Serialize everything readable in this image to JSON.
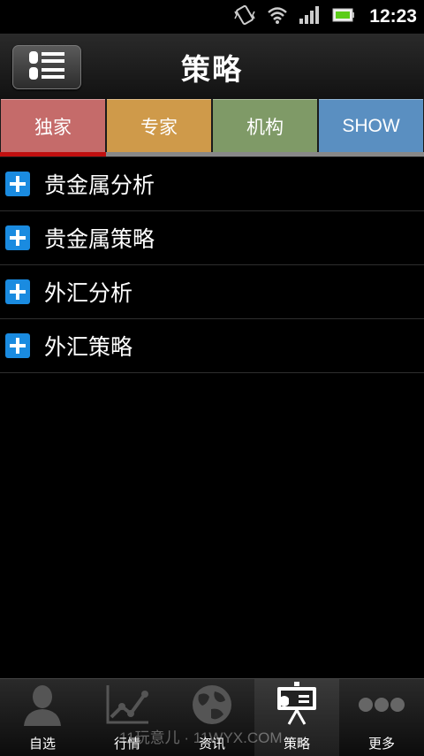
{
  "status_bar": {
    "time": "12:23"
  },
  "header": {
    "title": "策略"
  },
  "tabs": [
    {
      "label": "独家",
      "color": "#c56b6a"
    },
    {
      "label": "专家",
      "color": "#cf9a4a"
    },
    {
      "label": "机构",
      "color": "#7f9a67"
    },
    {
      "label": "SHOW",
      "color": "#5a8fc1"
    }
  ],
  "list": {
    "items": [
      {
        "label": "贵金属分析"
      },
      {
        "label": "贵金属策略"
      },
      {
        "label": "外汇分析"
      },
      {
        "label": "外汇策略"
      }
    ]
  },
  "bottom_nav": {
    "items": [
      {
        "label": "自选",
        "icon": "person-icon"
      },
      {
        "label": "行情",
        "icon": "chart-icon"
      },
      {
        "label": "资讯",
        "icon": "globe-icon"
      },
      {
        "label": "策略",
        "icon": "presentation-board-icon"
      },
      {
        "label": "更多",
        "icon": "more-dots-icon"
      }
    ]
  },
  "watermark": "11玩意儿 · 11WYX.COM",
  "colors": {
    "accent_red": "#c01010",
    "plus_blue": "#1a8be0"
  }
}
